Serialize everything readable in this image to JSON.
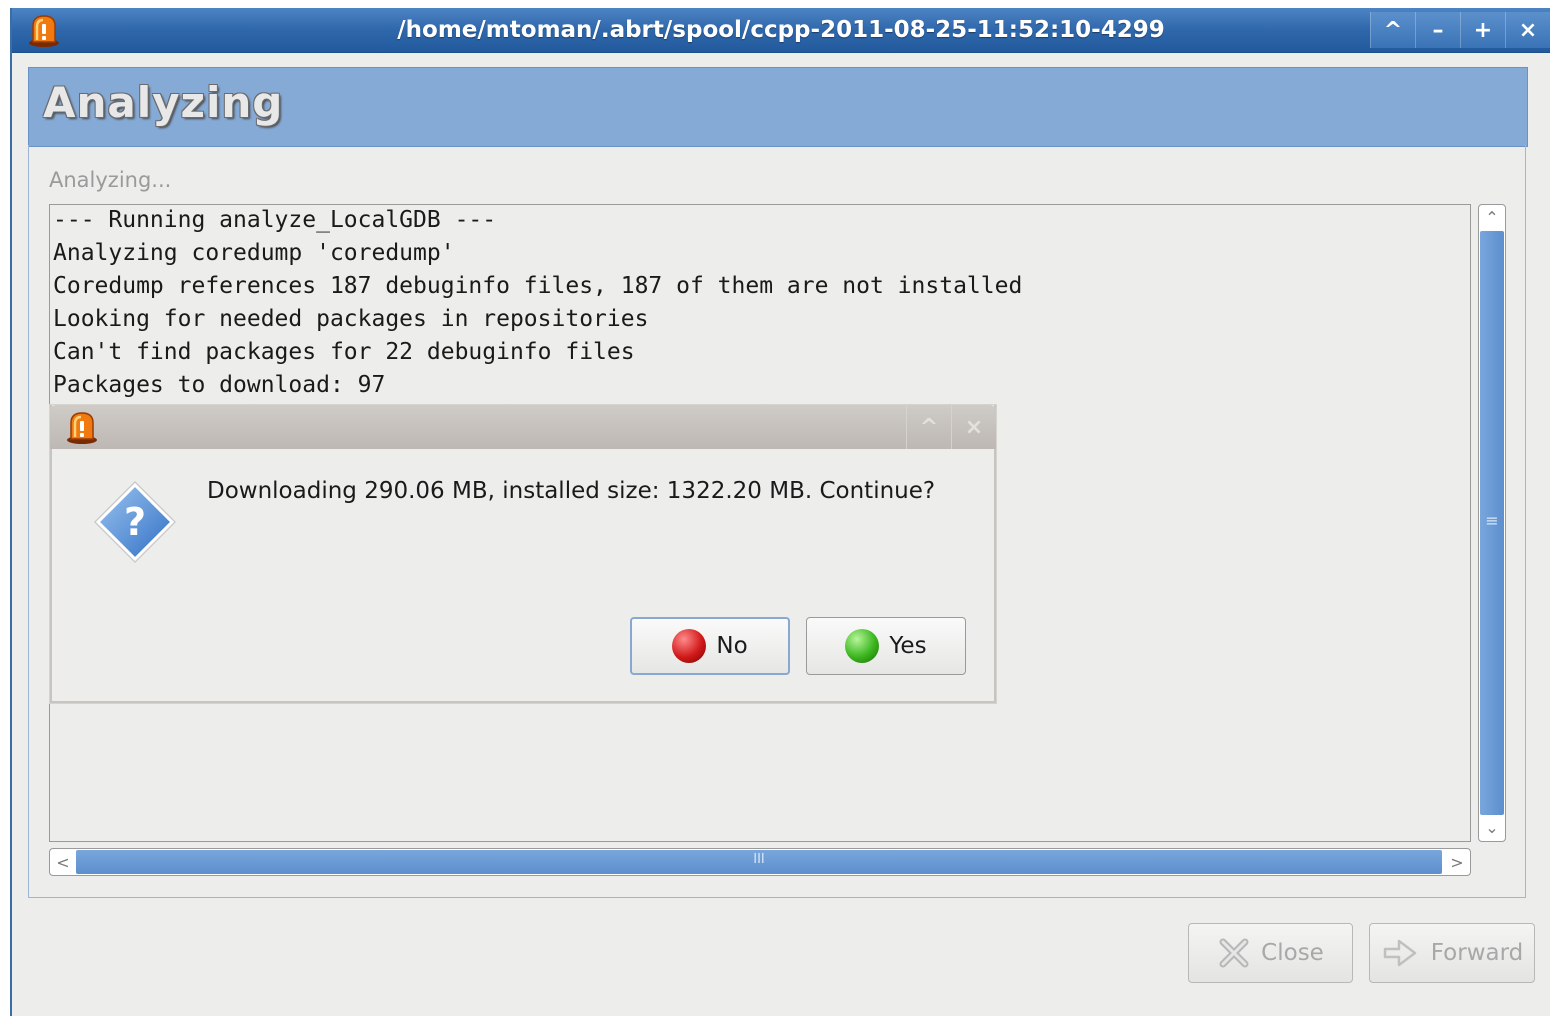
{
  "window": {
    "title": "/home/mtoman/.abrt/spool/ccpp-2011-08-25-11:52:10-4299",
    "controls": [
      "^",
      "–",
      "+",
      "×"
    ]
  },
  "header": {
    "title": "Analyzing"
  },
  "status": {
    "text": "Analyzing..."
  },
  "log": {
    "lines": [
      "--- Running analyze_LocalGDB ---",
      "Analyzing coredump 'coredump'",
      "Coredump references 187 debuginfo files, 187 of them are not installed",
      "Looking for needed packages in repositories",
      "Can't find packages for 22 debuginfo files",
      "Packages to download: 97"
    ]
  },
  "scrollbars": {
    "vertical_grip": "≡",
    "horizontal_grip": "III",
    "up": "⌃",
    "down": "⌄",
    "left": "<",
    "right": ">"
  },
  "dialog": {
    "controls": [
      "^",
      "×"
    ],
    "message": "Downloading 290.06 MB, installed size: 1322.20 MB. Continue?",
    "no_label": "No",
    "yes_label": "Yes"
  },
  "buttons": {
    "close_label": "Close",
    "forward_label": "Forward"
  },
  "colors": {
    "titlebar": "#2f67ab",
    "header_band": "#86aad6",
    "no_orb": "#d11a1a",
    "yes_orb": "#3bb61e"
  },
  "icons": {
    "app": "alarm-light-icon",
    "question": "question-diamond-icon",
    "close": "x-cross-icon",
    "forward": "forward-arrow-icon"
  }
}
